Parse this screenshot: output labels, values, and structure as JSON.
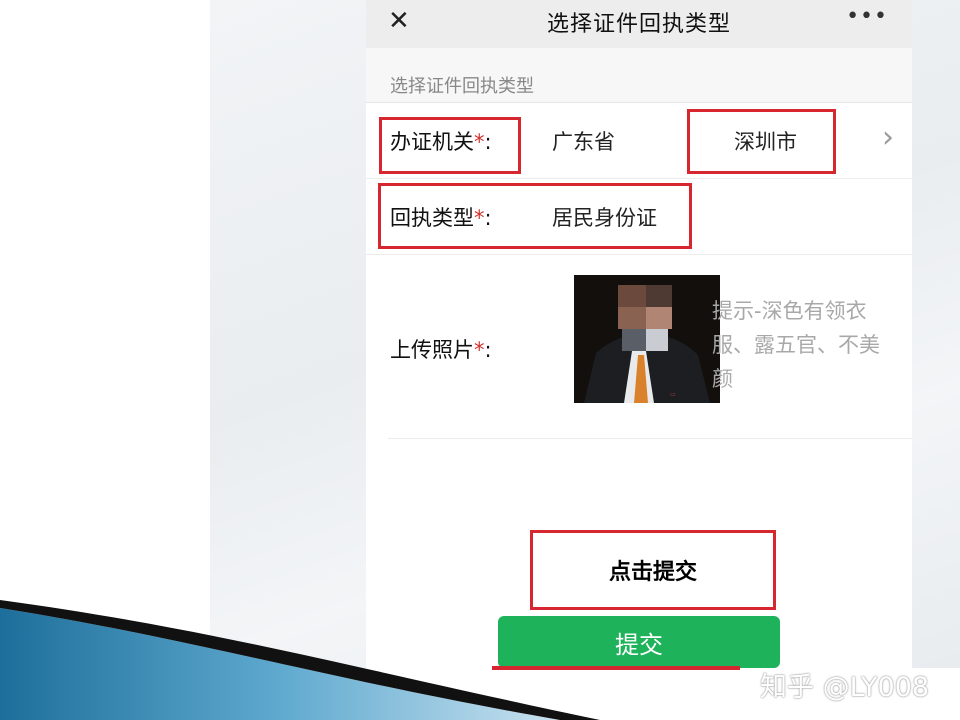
{
  "window": {
    "title": "选择证件回执类型",
    "close_icon": "close-icon",
    "more_icon": "more-icon",
    "more_glyph": "•••",
    "close_glyph": "✕"
  },
  "form": {
    "section_header": "选择证件回执类型",
    "authority": {
      "label": "办证机关",
      "required_mark": "*",
      "colon": ":",
      "province": "广东省",
      "city": "深圳市",
      "chevron_glyph": "›"
    },
    "receipt_type": {
      "label": "回执类型",
      "required_mark": "*",
      "colon": ":",
      "value": "居民身份证"
    },
    "photo": {
      "label": "上传照片",
      "required_mark": "*",
      "colon": ":",
      "hint": "提示-深色有领衣服、露五官、不美颜"
    }
  },
  "annotation": {
    "click_submit": "点击提交"
  },
  "submit_button": {
    "label": "提交"
  },
  "watermark": "知乎 @LY008",
  "colors": {
    "accent_green": "#1eb35a",
    "annotation_red": "#d6262f",
    "required_red": "#d0312d"
  }
}
